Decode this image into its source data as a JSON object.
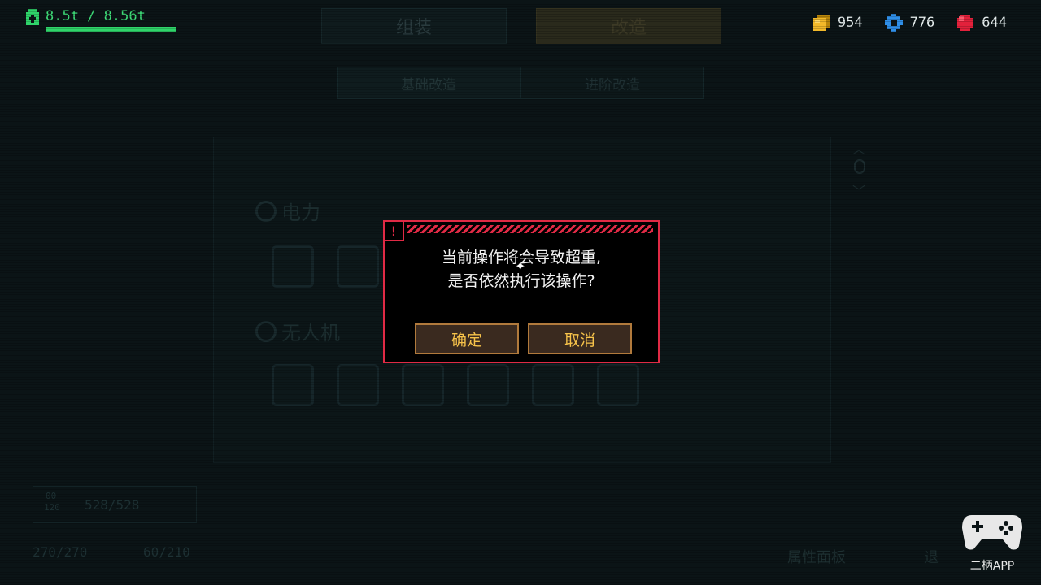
{
  "hud": {
    "weight_text": "8.5t / 8.56t",
    "weight_fill": 1.0
  },
  "top_tabs": [
    {
      "label": "组装",
      "active": false
    },
    {
      "label": "改造",
      "active": true
    }
  ],
  "currencies": [
    {
      "icon": "gold-block-icon",
      "value": "954",
      "color": "#f2b92a"
    },
    {
      "icon": "blue-gear-icon",
      "value": "776",
      "color": "#2f8fe8"
    },
    {
      "icon": "red-gem-icon",
      "value": "644",
      "color": "#e3213b"
    }
  ],
  "sub_tabs": [
    {
      "label": "基础改造",
      "active": true
    },
    {
      "label": "进阶改造",
      "active": false
    }
  ],
  "sections": [
    {
      "label": "电力",
      "icon": "lightning-icon"
    },
    {
      "label": "无人机",
      "icon": "drone-icon"
    }
  ],
  "stats": {
    "small_label_top": "00",
    "small_label_bottom": "120",
    "energy_text": "528/528",
    "hp_text": "270/270",
    "armor_text": "60/210"
  },
  "hints": {
    "panel_label": "属性面板",
    "esc_label": "退"
  },
  "dialog": {
    "alert_glyph": "!",
    "message_line1": "当前操作将会导致超重,",
    "message_line2": "是否依然执行该操作?",
    "confirm_label": "确定",
    "cancel_label": "取消",
    "border_color": "#e02a45",
    "button_text_color": "#f7c34a"
  },
  "watermark": {
    "text": "二柄APP"
  }
}
